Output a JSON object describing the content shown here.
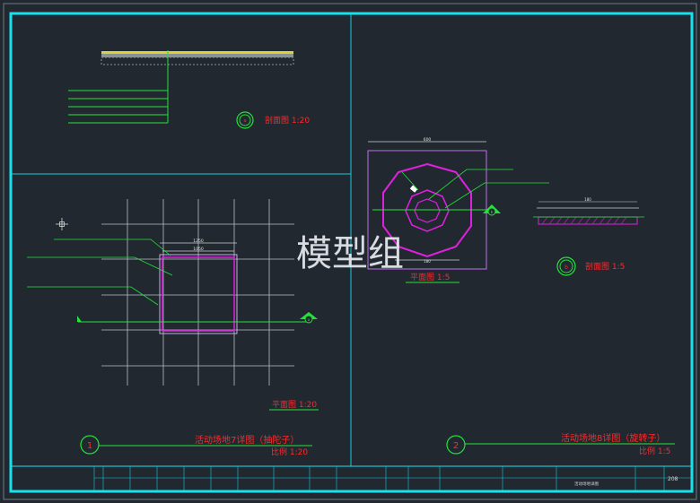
{
  "watermark": "模型组",
  "top_left": {
    "section_circle": "a",
    "section_title": "剖面图 1:20",
    "layers": [
      "",
      "",
      "",
      "",
      ""
    ]
  },
  "left": {
    "dim_top": "1250",
    "dim_inner": "1050",
    "callouts": [
      "",
      "",
      ""
    ],
    "section_mark": "a",
    "plan_title": "平面图 1:20",
    "detail_number": "1",
    "detail_title": "活动场地7详图（抽陀子）",
    "detail_scale": "比例 1:20"
  },
  "right": {
    "dim_top": "600",
    "dim_bottom": "180",
    "callouts": [
      "",
      ""
    ],
    "section_mark": "b",
    "plan_title": "平面图 1:5",
    "section_circle": "b",
    "section_title": "剖面图 1:5",
    "dim_section": "180",
    "detail_number": "2",
    "detail_title": "活动场地8详图（旋转子）",
    "detail_scale": "比例 1:5"
  },
  "title_block": {
    "cells_row1": [
      "",
      "",
      "",
      "",
      "",
      "",
      "",
      "",
      "",
      "",
      "",
      "",
      ""
    ],
    "cells_row2": [
      "",
      "",
      "",
      "",
      "",
      "",
      "",
      "",
      "",
      "",
      "",
      "",
      ""
    ],
    "drawing_name": "活动场地详图",
    "sheet_no": "208"
  }
}
